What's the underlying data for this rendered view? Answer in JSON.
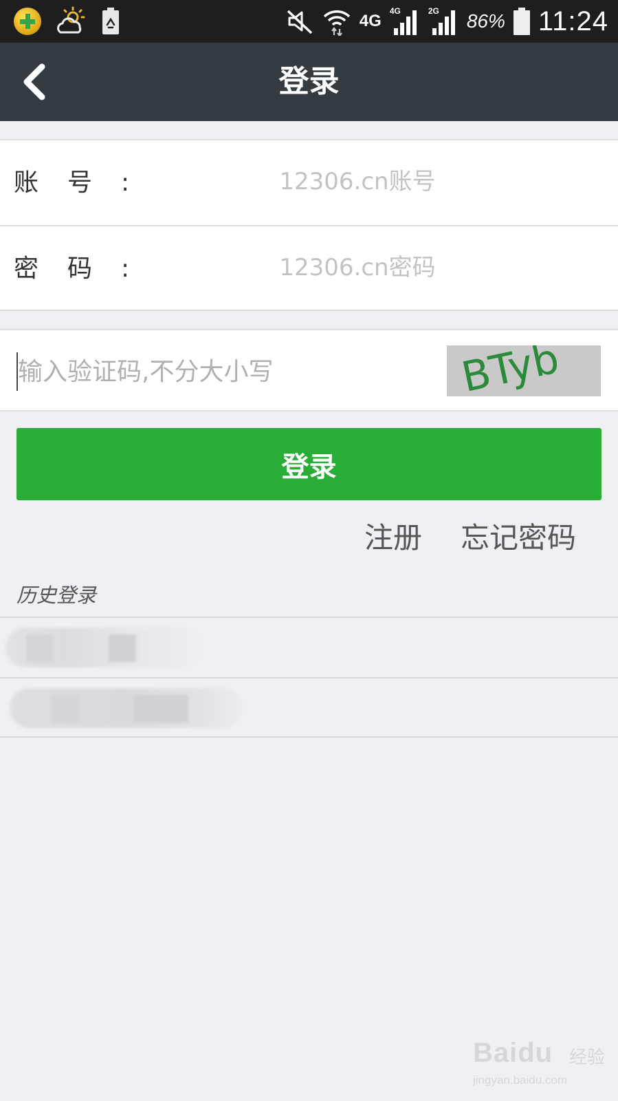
{
  "status_bar": {
    "icons_left": [
      "360-security-icon",
      "weather-partly-cloudy-icon",
      "battery-saver-icon"
    ],
    "icons_right": [
      "mute-icon",
      "wifi-icon",
      "4g-signal-icon",
      "2g-signal-icon",
      "battery-icon"
    ],
    "network_label": "4G",
    "signal_1_tag": "4G",
    "signal_2_tag": "2G",
    "battery_percent": "86%",
    "time": "11:24"
  },
  "nav": {
    "title": "登录"
  },
  "form": {
    "account": {
      "label": "账号",
      "colon": ":",
      "placeholder": "12306.cn账号",
      "value": ""
    },
    "password": {
      "label": "密码",
      "colon": ":",
      "placeholder": "12306.cn密码",
      "value": ""
    },
    "captcha": {
      "placeholder": "输入验证码,不分大小写",
      "value": "",
      "image_text": "BTyb"
    }
  },
  "actions": {
    "login_label": "登录",
    "register_label": "注册",
    "forgot_password_label": "忘记密码"
  },
  "history": {
    "label": "历史登录",
    "item_count": 2
  },
  "watermark": {
    "logo": "Baidu",
    "suffix": "经验",
    "url": "jingyan.baidu.com"
  },
  "colors": {
    "status_bar_bg": "#1e1e1e",
    "nav_bg": "#353c41",
    "page_bg": "#efeff4",
    "primary_button": "#2aad37",
    "placeholder": "#c2c2c2",
    "captcha_text": "#2a8a3a"
  }
}
